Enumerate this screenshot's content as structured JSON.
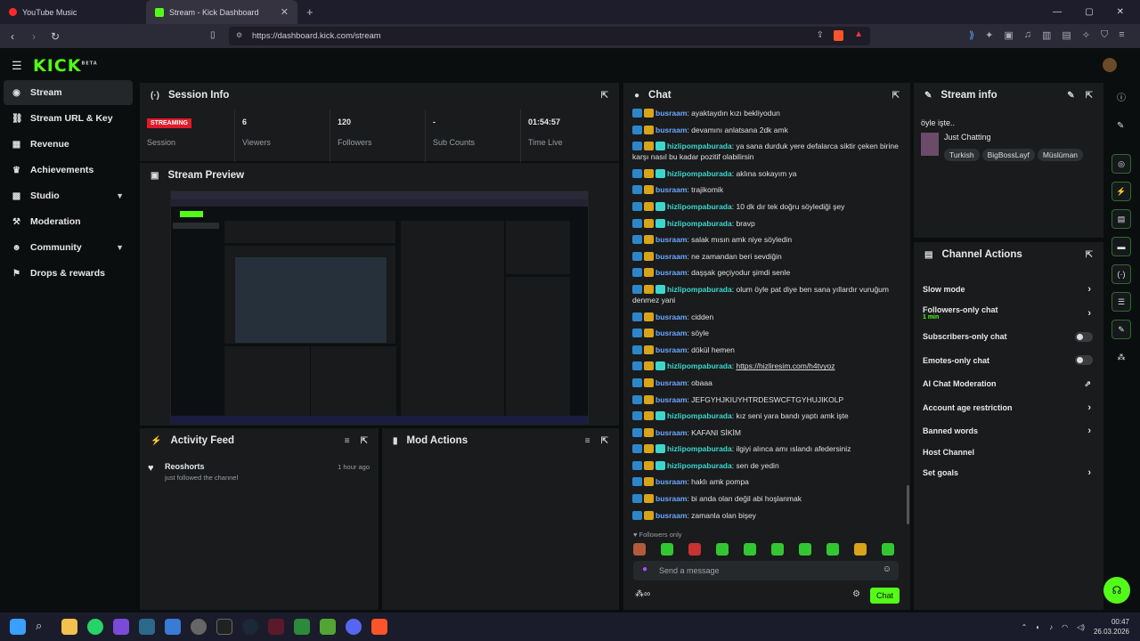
{
  "browser": {
    "tabs": [
      {
        "title": "YouTube Music"
      },
      {
        "title": "Stream - Kick Dashboard"
      }
    ],
    "url": "https://dashboard.kick.com/stream"
  },
  "app": {
    "logo": "KICK",
    "logo_tag": "BETA",
    "sidebar": [
      {
        "label": "Stream",
        "icon": "broadcast-icon"
      },
      {
        "label": "Stream URL & Key",
        "icon": "link-icon"
      },
      {
        "label": "Revenue",
        "icon": "chart-icon"
      },
      {
        "label": "Achievements",
        "icon": "trophy-icon"
      },
      {
        "label": "Studio",
        "icon": "studio-icon"
      },
      {
        "label": "Moderation",
        "icon": "hammer-icon"
      },
      {
        "label": "Community",
        "icon": "people-icon"
      },
      {
        "label": "Drops & rewards",
        "icon": "gift-icon"
      }
    ]
  },
  "session": {
    "title": "Session Info",
    "status": "STREAMING",
    "status_label": "Session",
    "viewers": "6",
    "viewers_label": "Viewers",
    "followers": "120",
    "followers_label": "Followers",
    "subs": "-",
    "subs_label": "Sub Counts",
    "time": "01:54:57",
    "time_label": "Time Live"
  },
  "preview": {
    "title": "Stream Preview"
  },
  "activity": {
    "title": "Activity Feed",
    "items": [
      {
        "name": "Reoshorts",
        "text": "just followed the channel",
        "time": "1 hour ago"
      }
    ]
  },
  "mod": {
    "title": "Mod Actions"
  },
  "chat": {
    "title": "Chat",
    "messages": [
      {
        "user": "busraam",
        "color": "blue",
        "text": "ayaktaydın kızı bekliyodun"
      },
      {
        "user": "busraam",
        "color": "blue",
        "text": "devamını anlatsana 2dk amk"
      },
      {
        "user": "hizlipompaburada",
        "color": "teal",
        "text": "ya sana durduk yere defalarca siktir çeken birine karşı nasıl bu kadar pozitif olabilirsin"
      },
      {
        "user": "hizlipompaburada",
        "color": "teal",
        "text": "aklına sokayım ya"
      },
      {
        "user": "busraam",
        "color": "blue",
        "text": "trajikomik"
      },
      {
        "user": "hizlipompaburada",
        "color": "teal",
        "text": "10 dk dır tek doğru söylediği şey"
      },
      {
        "user": "hizlipompaburada",
        "color": "teal",
        "text": "bravp"
      },
      {
        "user": "busraam",
        "color": "blue",
        "text": "salak mısın amk niye söyledin"
      },
      {
        "user": "busraam",
        "color": "blue",
        "text": "ne zamandan beri sevdiğin"
      },
      {
        "user": "busraam",
        "color": "blue",
        "text": "daşşak geçiyodur şimdi senle"
      },
      {
        "user": "hizlipompaburada",
        "color": "teal",
        "text": "olum öyle pat diye ben sana yıllardır vuruğum denmez yani"
      },
      {
        "user": "busraam",
        "color": "blue",
        "text": "cidden"
      },
      {
        "user": "busraam",
        "color": "blue",
        "text": "söyle"
      },
      {
        "user": "busraam",
        "color": "blue",
        "text": "dökül hemen"
      },
      {
        "user": "hizlipompaburada",
        "color": "teal",
        "text": "https://hizliresim.com/h4tvyoz"
      },
      {
        "user": "busraam",
        "color": "blue",
        "text": "obaaa"
      },
      {
        "user": "busraam",
        "color": "blue",
        "text": "JEFGYHJKIUYHTRDESWCFTGYHUJIKOLP"
      },
      {
        "user": "hizlipompaburada",
        "color": "teal",
        "text": "kız seni yara bandı yaptı amk işte"
      },
      {
        "user": "busraam",
        "color": "blue",
        "text": "KAFANI SİKİM"
      },
      {
        "user": "hizlipompaburada",
        "color": "teal",
        "text": "ilgiyi alınca amı ıslandı afedersiniz"
      },
      {
        "user": "hizlipompaburada",
        "color": "teal",
        "text": "sen de yedin"
      },
      {
        "user": "busraam",
        "color": "blue",
        "text": "haklı amk pompa"
      },
      {
        "user": "busraam",
        "color": "blue",
        "text": "bi anda olan değil abi hoşlanmak"
      },
      {
        "user": "busraam",
        "color": "blue",
        "text": "zamanla olan bişey"
      }
    ],
    "followers_only": "Followers only",
    "placeholder": "Send a message",
    "send": "Chat"
  },
  "stream_info": {
    "title": "Stream info",
    "stream_title": "öyle işte..",
    "category": "Just Chatting",
    "tags": [
      "Turkish",
      "BigBossLayf",
      "Müslüman"
    ]
  },
  "channel_actions": {
    "title": "Channel Actions",
    "items": [
      {
        "label": "Slow mode",
        "sub": "",
        "control": "chevron"
      },
      {
        "label": "Followers-only chat",
        "sub": "1 min",
        "control": "chevron"
      },
      {
        "label": "Subscribers-only chat",
        "sub": "",
        "control": "toggle"
      },
      {
        "label": "Emotes-only chat",
        "sub": "",
        "control": "toggle"
      },
      {
        "label": "AI Chat Moderation",
        "sub": "",
        "control": "external"
      },
      {
        "label": "Account age restriction",
        "sub": "",
        "control": "chevron"
      },
      {
        "label": "Banned words",
        "sub": "",
        "control": "chevron"
      },
      {
        "label": "Host Channel",
        "sub": "",
        "control": "none"
      },
      {
        "label": "Set goals",
        "sub": "",
        "control": "chevron"
      }
    ]
  },
  "taskbar": {
    "time": "00:47",
    "date": "26.03.2026"
  },
  "colors": {
    "accent": "#53fc18",
    "bg": "#0b0e0f",
    "panel": "#191b1c",
    "live": "#e11a2a"
  }
}
